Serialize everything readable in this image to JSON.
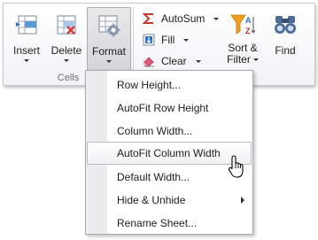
{
  "ribbon": {
    "cells_group": {
      "label": "Cells",
      "buttons": [
        {
          "label": "Insert",
          "icon": "insert-rows-icon"
        },
        {
          "label": "Delete",
          "icon": "delete-rows-icon"
        },
        {
          "label": "Format",
          "icon": "format-cells-icon",
          "active": true
        }
      ]
    },
    "editing_group": {
      "autosum_label": "AutoSum",
      "fill_label": "Fill",
      "clear_label": "Clear",
      "sort_filter_label_line1": "Sort &",
      "sort_filter_label_line2": "Filter",
      "find_label": "Find"
    }
  },
  "menu": {
    "items": [
      {
        "label": "Row Height..."
      },
      {
        "label": "AutoFit Row Height"
      },
      {
        "label": "Column Width..."
      },
      {
        "label": "AutoFit Column Width",
        "highlighted": true
      },
      {
        "label": "Default Width..."
      },
      {
        "label": "Hide & Unhide",
        "has_submenu": true
      },
      {
        "label": "Rename Sheet..."
      }
    ]
  },
  "colors": {
    "autosum_sigma": "#c0392b",
    "fill_blue": "#2f6fc7",
    "eraser_pink": "#e05a7a",
    "funnel_orange": "#f0a020",
    "binoculars": "#4a6c96"
  }
}
